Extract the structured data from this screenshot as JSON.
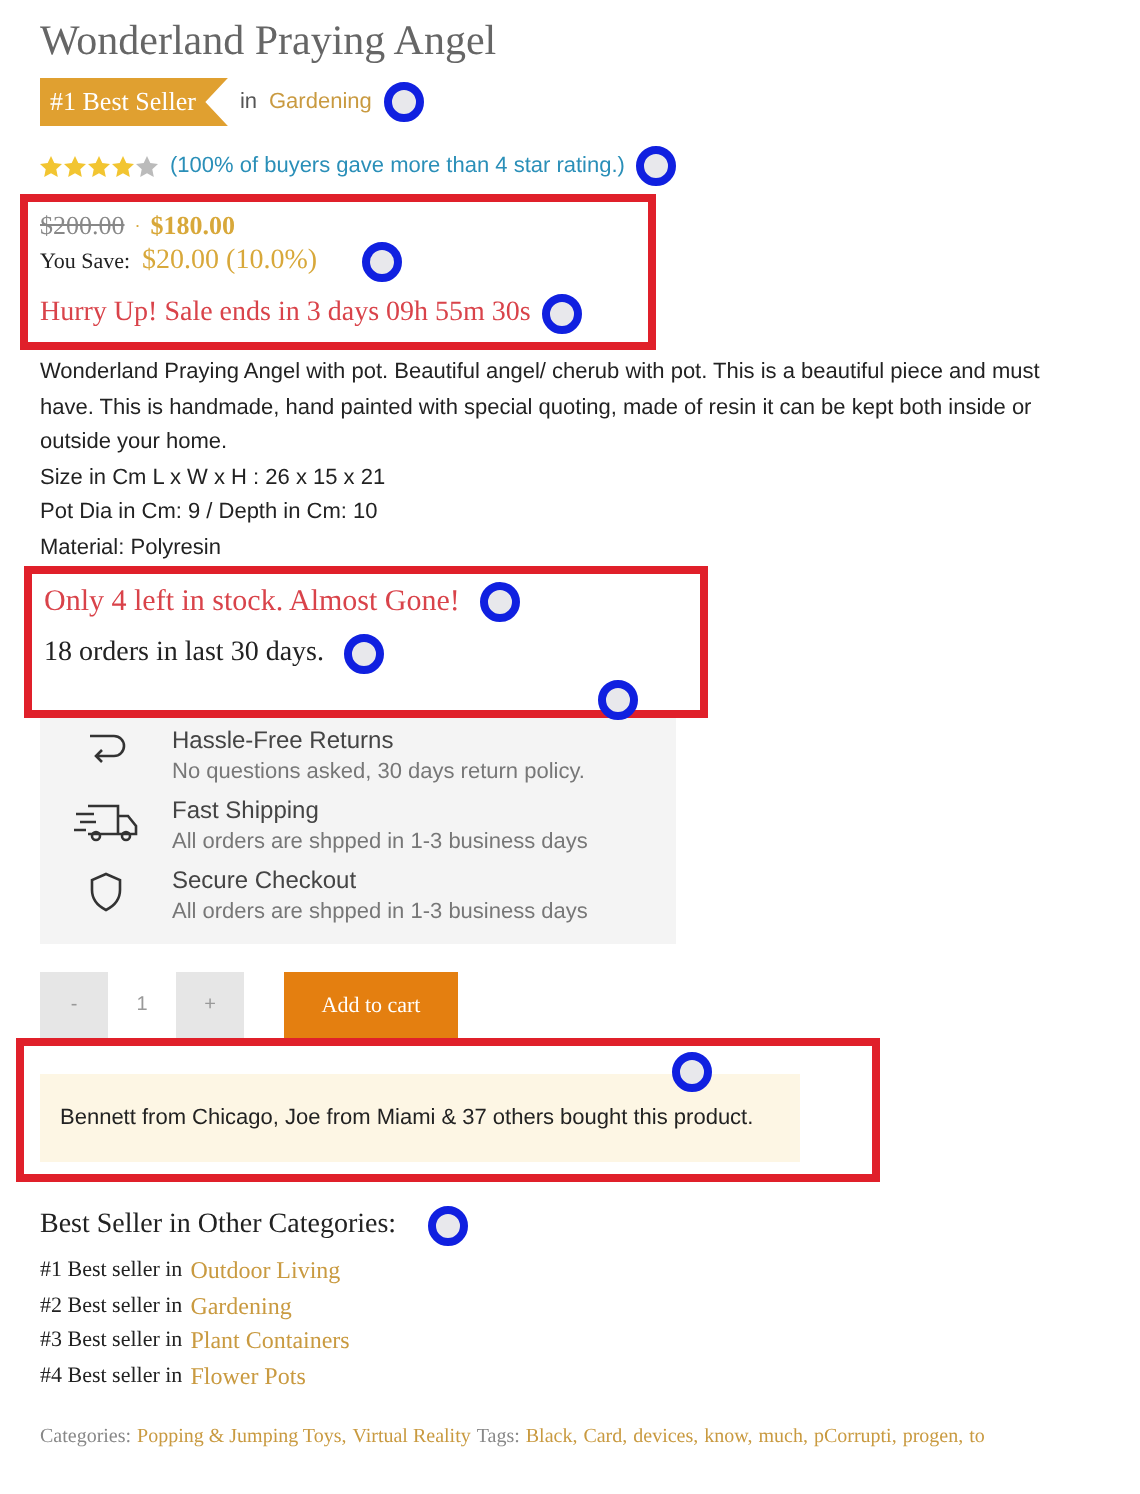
{
  "title": "Wonderland Praying Angel",
  "badge": {
    "label": "#1 Best Seller",
    "prefix": "in",
    "category": "Gardening",
    "marked": true
  },
  "rating": {
    "stars": 4,
    "text": "(100% of buyers gave more than 4 star rating.)",
    "marked": true
  },
  "price_box": {
    "highlighted": true,
    "old_price": "$200.00",
    "separator": "·",
    "new_price": "$180.00",
    "save_label": "You Save:",
    "save_value": "$20.00 (10.0%)",
    "save_marked": true,
    "countdown": "Hurry Up! Sale ends in 3 days 09h 55m 30s",
    "countdown_marked": true
  },
  "description": [
    "Wonderland Praying Angel with pot. Beautiful angel/ cherub with pot. This is a beautiful piece and must have. This is handmade, hand painted with special quoting, made of resin it can be kept both inside or outside your home.",
    "Size in Cm L x W x H : 26 x 15 x 21",
    "Pot Dia in Cm: 9 / Depth in Cm: 10",
    "Material: Polyresin"
  ],
  "stock_box": {
    "highlighted": true,
    "stock": "Only 4 left in stock. Almost Gone!",
    "stock_marked": true,
    "orders": "18 orders in last 30 days.",
    "orders_marked": true,
    "corner_marked": true
  },
  "features": [
    {
      "kind": "returns",
      "title": "Hassle-Free Returns",
      "text": "No questions asked, 30 days return policy."
    },
    {
      "kind": "shipping",
      "title": "Fast Shipping",
      "text": "All orders are shpped in 1-3 business days"
    },
    {
      "kind": "secure",
      "title": "Secure Checkout",
      "text": "All orders are shpped in 1-3 business days"
    }
  ],
  "cart": {
    "minus": "-",
    "quantity": "1",
    "plus": "+",
    "button": "Add to cart"
  },
  "buyers_box": {
    "highlighted": true,
    "text": "Bennett from Chicago, Joe from Miami & 37 others bought this product.",
    "marked": true
  },
  "other_categories": {
    "heading": "Best Seller in Other Categories:",
    "marked": true,
    "items": [
      {
        "rank": "#1 Best seller in",
        "category": "Outdoor Living"
      },
      {
        "rank": "#2 Best seller in",
        "category": "Gardening"
      },
      {
        "rank": "#3 Best seller in",
        "category": "Plant Containers"
      },
      {
        "rank": "#4 Best seller in",
        "category": "Flower Pots"
      }
    ]
  },
  "meta": {
    "categories_label": "Categories:",
    "categories": [
      "Popping & Jumping Toys,",
      "Virtual Reality"
    ],
    "tags_label": "Tags:",
    "tags": [
      "Black,",
      "Card,",
      "devices,",
      "know,",
      "much,",
      "pCorrupti,",
      "progen,",
      "to"
    ]
  }
}
